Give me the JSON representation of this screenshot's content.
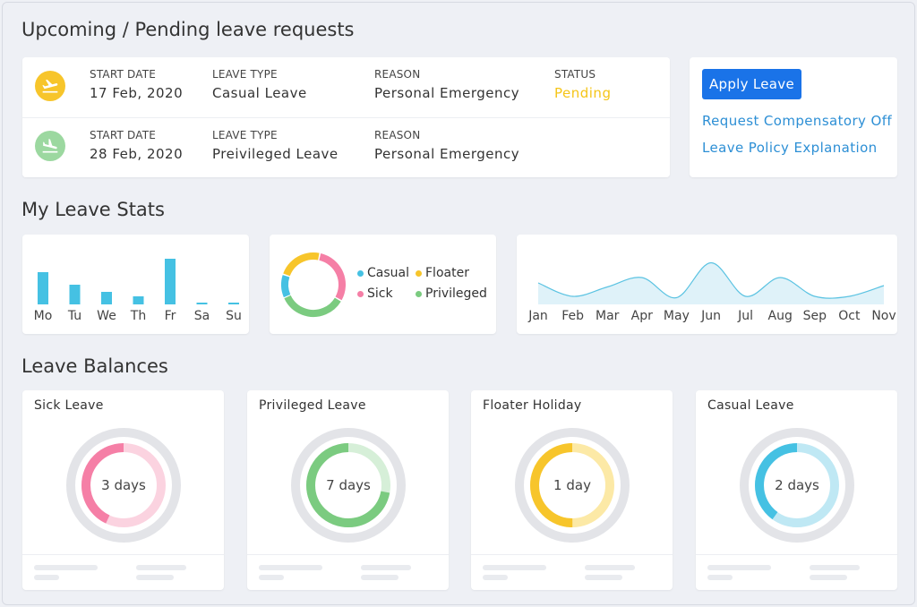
{
  "sections": {
    "requests_title": "Upcoming / Pending leave requests",
    "stats_title": "My Leave Stats",
    "balances_title": "Leave Balances"
  },
  "requests": [
    {
      "icon": "airplane-takeoff-icon",
      "icon_color": "#f7c52b",
      "start_label": "START DATE",
      "start_value": "17 Feb, 2020",
      "type_label": "LEAVE TYPE",
      "type_value": "Casual Leave",
      "reason_label": "REASON",
      "reason_value": "Personal Emergency",
      "status_label": "STATUS",
      "status_value": "Pending",
      "status_color": "#f5c518"
    },
    {
      "icon": "airplane-landing-icon",
      "icon_color": "#9cd8a0",
      "start_label": "START DATE",
      "start_value": "28 Feb, 2020",
      "type_label": "LEAVE TYPE",
      "type_value": "Preivileged Leave",
      "reason_label": "REASON",
      "reason_value": "Personal Emergency"
    }
  ],
  "actions": {
    "apply_label": "Apply Leave",
    "links": [
      "Request Compensatory Off",
      "Leave Policy Explanation"
    ],
    "apply_color": "#1a73e8",
    "link_color": "#2d8fd5"
  },
  "chart_data": [
    {
      "type": "bar",
      "categories": [
        "Mo",
        "Tu",
        "We",
        "Th",
        "Fr",
        "Sa",
        "Su"
      ],
      "values": [
        3.6,
        2.2,
        1.4,
        0.9,
        5.1,
        0.2,
        0.2
      ],
      "color": "#45c1e3",
      "ylim": [
        0,
        6
      ]
    },
    {
      "type": "pie",
      "style": "donut",
      "labels": [
        "Casual",
        "Floater",
        "Sick",
        "Privileged"
      ],
      "values": [
        12,
        23,
        30,
        35
      ],
      "colors": [
        "#45c1e3",
        "#f7c52b",
        "#f57fa6",
        "#7bcb80"
      ]
    },
    {
      "type": "area",
      "categories": [
        "Jan",
        "Feb",
        "Mar",
        "Apr",
        "May",
        "Jun",
        "Jul",
        "Aug",
        "Sep",
        "Oct",
        "Nov"
      ],
      "values": [
        3.2,
        1.2,
        2.6,
        4.0,
        1.0,
        6.2,
        1.2,
        4.0,
        1.2,
        1.2,
        2.8
      ],
      "ylim": [
        0,
        8
      ],
      "line_color": "#5bc3e2",
      "fill_color": "#dff2f9"
    }
  ],
  "balances": [
    {
      "title": "Sick Leave",
      "label": "3 days",
      "fraction": 0.43,
      "color": "#f57fa6",
      "light": "#fbd3e0"
    },
    {
      "title": "Privileged Leave",
      "label": "7 days",
      "fraction": 0.72,
      "color": "#7bcb80",
      "light": "#d6efd8"
    },
    {
      "title": "Floater Holiday",
      "label": "1 day",
      "fraction": 0.5,
      "color": "#f7c52b",
      "light": "#fce9a6"
    },
    {
      "title": "Casual Leave",
      "label": "2 days",
      "fraction": 0.4,
      "color": "#45c1e3",
      "light": "#bfe8f4"
    }
  ]
}
